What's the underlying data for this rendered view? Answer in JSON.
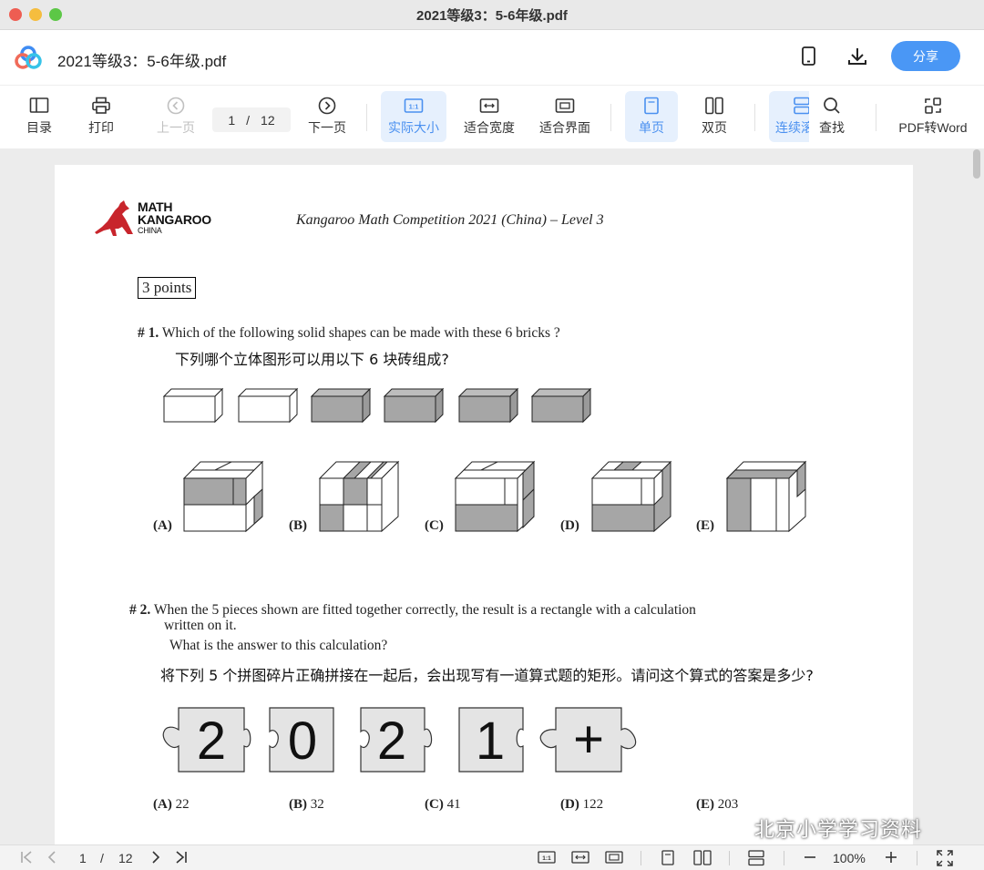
{
  "window": {
    "title": "2021等级3：5-6年级.pdf"
  },
  "header": {
    "doc_name": "2021等级3：5-6年级.pdf",
    "share_label": "分享"
  },
  "toolbar": {
    "toc": "目录",
    "print": "打印",
    "prev": "上一页",
    "page_current": "1",
    "page_sep": "/",
    "page_total": "12",
    "next": "下一页",
    "actual_size": "实际大小",
    "fit_width": "适合宽度",
    "fit_page": "适合界面",
    "single": "单页",
    "double": "双页",
    "continuous": "连续滚动",
    "search": "查找",
    "pdf_to_word": "PDF转Word"
  },
  "document": {
    "logo_line1": "MATH",
    "logo_line2": "KANGAROO",
    "logo_line3": "CHINA",
    "competition": "Kangaroo Math Competition 2021 (China) – Level 3",
    "points": "3 points",
    "q1": {
      "num": "# 1.",
      "en": "Which of the following solid shapes can be made with these 6 bricks ?",
      "cn": "下列哪个立体图形可以用以下 6 块砖组成?",
      "options": [
        "(A)",
        "(B)",
        "(C)",
        "(D)",
        "(E)"
      ]
    },
    "q2": {
      "num": "# 2.",
      "en1": "When the 5 pieces shown are fitted together correctly, the result is a rectangle with a calculation",
      "en2": "written on it.",
      "en3": "What is the answer to this calculation?",
      "cn": "将下列 5 个拼图碎片正确拼接在一起后，会出现写有一道算式题的矩形。请问这个算式的答案是多少?",
      "pieces": [
        "2",
        "0",
        "2",
        "1",
        "+"
      ],
      "options": [
        {
          "letter": "(A)",
          "value": "22"
        },
        {
          "letter": "(B)",
          "value": "32"
        },
        {
          "letter": "(C)",
          "value": "41"
        },
        {
          "letter": "(D)",
          "value": "122"
        },
        {
          "letter": "(E)",
          "value": "203"
        }
      ]
    }
  },
  "statusbar": {
    "page_current": "1",
    "page_sep": "/",
    "page_total": "12",
    "zoom": "100%"
  },
  "watermark": "北京小学学习资料",
  "colors": {
    "accent": "#4a97f5",
    "brick_gray": "#a6a6a6"
  }
}
